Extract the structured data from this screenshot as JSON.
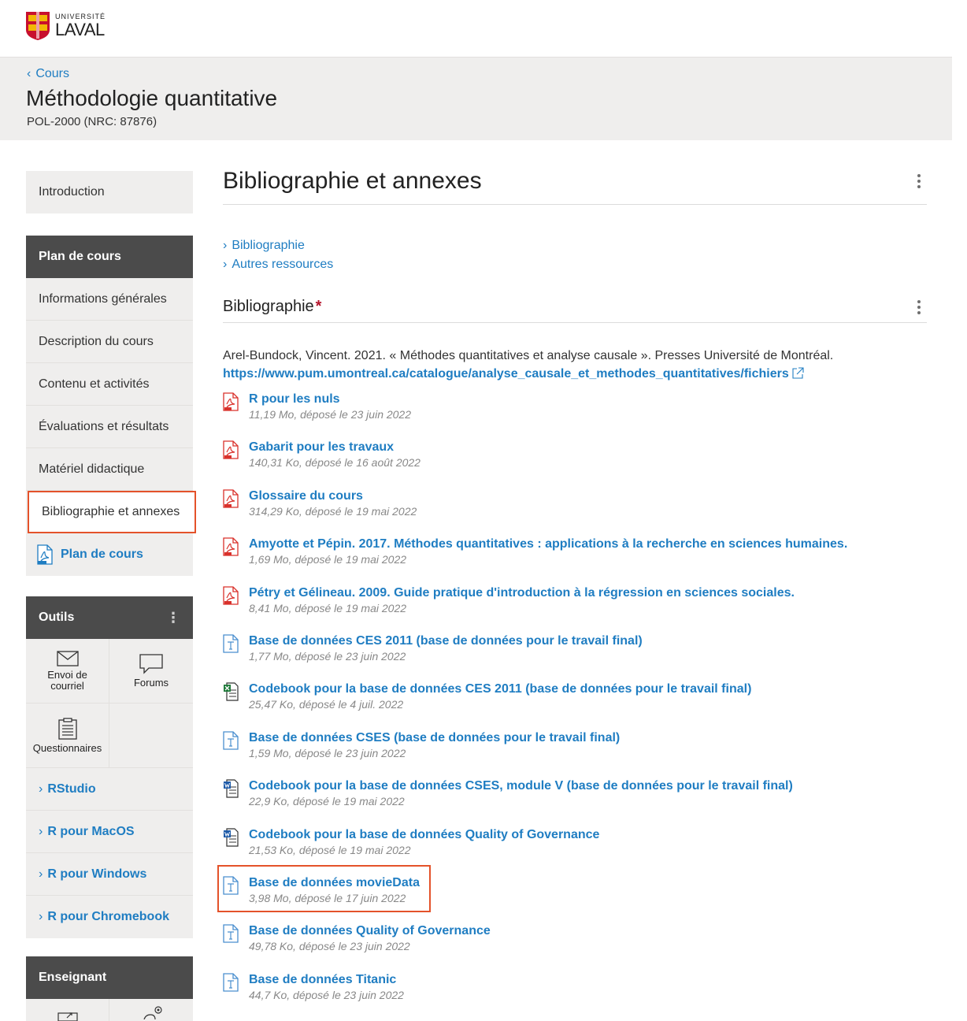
{
  "brand": {
    "small": "UNIVERSITÉ",
    "big": "LAVAL"
  },
  "course": {
    "back_label": "Cours",
    "title": "Méthodologie quantitative",
    "code": "POL-2000 (NRC: 87876)"
  },
  "sidebar": {
    "intro": "Introduction",
    "plan_heading": "Plan de cours",
    "plan_items": [
      "Informations générales",
      "Description du cours",
      "Contenu et activités",
      "Évaluations et résultats",
      "Matériel didactique",
      "Bibliographie et annexes"
    ],
    "plan_pdf": "Plan de cours",
    "tools_heading": "Outils",
    "tools": [
      {
        "label": "Envoi de courriel",
        "icon": "envelope-icon"
      },
      {
        "label": "Forums",
        "icon": "speech-bubble-icon"
      },
      {
        "label": "Questionnaires",
        "icon": "clipboard-icon"
      }
    ],
    "tool_links": [
      "RStudio",
      "R pour MacOS",
      "R pour Windows",
      "R pour Chromebook"
    ],
    "teacher_heading": "Enseignant"
  },
  "main": {
    "title": "Bibliographie et annexes",
    "anchors": [
      "Bibliographie",
      "Autres ressources"
    ],
    "section_title": "Bibliographie",
    "required_mark": "*",
    "citation_text": "Arel-Bundock, Vincent. 2021. « Méthodes quantitatives et analyse causale ». Presses Université de Montréal.",
    "citation_url": "https://www.pum.umontreal.ca/catalogue/analyse_causale_et_methodes_quantitatives/fichiers",
    "files": [
      {
        "name": "R pour les nuls",
        "meta": "11,19 Mo, déposé le 23 juin 2022",
        "type": "pdf"
      },
      {
        "name": "Gabarit pour les travaux",
        "meta": "140,31 Ko, déposé le 16 août 2022",
        "type": "pdf"
      },
      {
        "name": "Glossaire du cours",
        "meta": "314,29 Ko, déposé le 19 mai 2022",
        "type": "pdf"
      },
      {
        "name": "Amyotte et Pépin. 2017. Méthodes quantitatives : applications à la recherche en sciences humaines.",
        "meta": "1,69 Mo, déposé le 19 mai 2022",
        "type": "pdf"
      },
      {
        "name": "Pétry et Gélineau. 2009. Guide pratique d'introduction à la régression en sciences sociales.",
        "meta": "8,41 Mo, déposé le 19 mai 2022",
        "type": "pdf"
      },
      {
        "name": "Base de données CES 2011 (base de données pour le travail final)",
        "meta": "1,77 Mo, déposé le 23 juin 2022",
        "type": "text"
      },
      {
        "name": "Codebook pour la base de données CES 2011 (base de données pour le travail final)",
        "meta": "25,47 Ko, déposé le 4 juil. 2022",
        "type": "excel"
      },
      {
        "name": "Base de données CSES (base de données pour le travail final)",
        "meta": "1,59 Mo, déposé le 23 juin 2022",
        "type": "text"
      },
      {
        "name": "Codebook pour la base de données CSES, module V (base de données pour le travail final)",
        "meta": "22,9 Ko, déposé le 19 mai 2022",
        "type": "word"
      },
      {
        "name": "Codebook pour la base de données Quality of Governance",
        "meta": "21,53 Ko, déposé le 19 mai 2022",
        "type": "word"
      },
      {
        "name": "Base de données movieData",
        "meta": "3,98 Mo, déposé le 17 juin 2022",
        "type": "text"
      },
      {
        "name": "Base de données Quality of Governance",
        "meta": "49,78 Ko, déposé le 23 juin 2022",
        "type": "text"
      },
      {
        "name": "Base de données Titanic",
        "meta": "44,7 Ko, déposé le 23 juin 2022",
        "type": "text"
      }
    ]
  },
  "colors": {
    "link": "#1f7dc2",
    "highlight": "#e4522a",
    "dark_header": "#4b4b4b",
    "panel": "#efeeed",
    "required": "#b4142c"
  }
}
